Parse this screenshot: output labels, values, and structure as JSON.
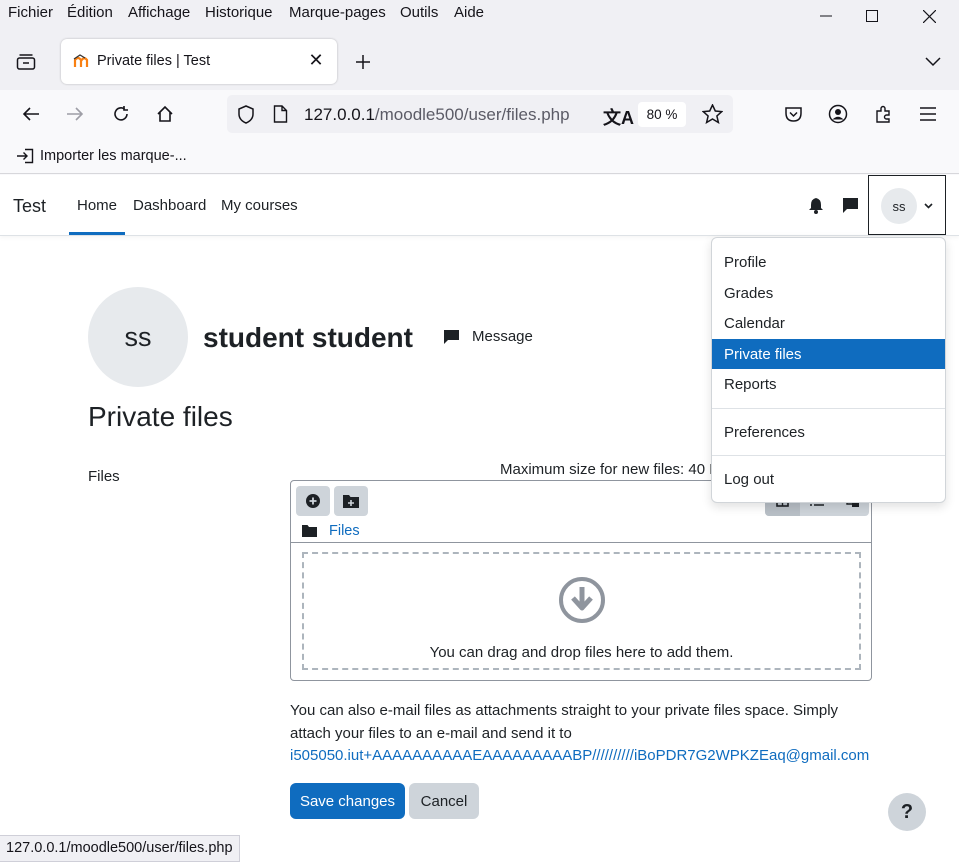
{
  "browser": {
    "menu": [
      "Fichier",
      "Édition",
      "Affichage",
      "Historique",
      "Marque-pages",
      "Outils",
      "Aide"
    ],
    "tab_title": "Private files | Test",
    "url_host": "127.0.0.1",
    "url_path": "/moodle500/user/files.php",
    "zoom": "80 %",
    "bookmark_import": "Importer les marque-...",
    "status_url": "127.0.0.1/moodle500/user/files.php"
  },
  "site": {
    "brand": "Test",
    "nav": {
      "home": "Home",
      "dashboard": "Dashboard",
      "my_courses": "My courses"
    },
    "user_initials": "ss"
  },
  "profile": {
    "initials": "ss",
    "fullname": "student student",
    "message_label": "Message"
  },
  "page": {
    "heading": "Private files",
    "files_label": "Files",
    "max_size": "Maximum size for new files: 40 MB",
    "path_root": "Files",
    "drop_hint": "You can drag and drop files here to add them.",
    "email_note": "You can also e-mail files as attachments straight to your private files space. Simply attach your files to an e-mail and send it to",
    "email_address": "i505050.iut+AAAAAAAAAAEAAAAAAAAABP//////////iBoPDR7G2WPKZEaq@gmail.com",
    "save_label": "Save changes",
    "cancel_label": "Cancel",
    "help_label": "?"
  },
  "user_menu": {
    "items": [
      "Profile",
      "Grades",
      "Calendar",
      "Private files",
      "Reports"
    ],
    "active": "Private files",
    "preferences": "Preferences",
    "logout": "Log out"
  },
  "colors": {
    "primary": "#0f6cbf",
    "secondary_btn": "#ced4da",
    "avatar_bg": "#e7eaed"
  }
}
